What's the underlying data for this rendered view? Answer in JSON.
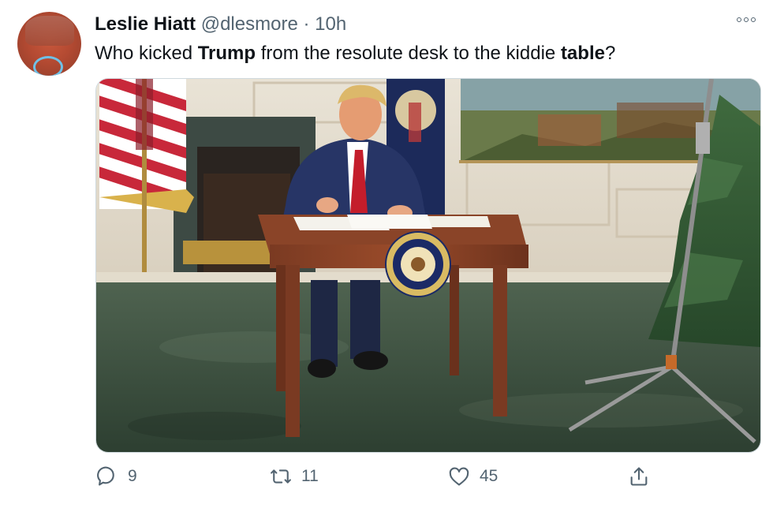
{
  "tweet": {
    "author_name": "Leslie Hiatt",
    "handle": "@dlesmore",
    "separator": "·",
    "time": "10h",
    "text_parts": [
      "Who kicked ",
      "Trump",
      " from the resolute desk to the kiddie ",
      "table",
      "?"
    ],
    "media_seal_text": "SEAL OF THE PRESIDENT OF THE UNITED STATES"
  },
  "actions": {
    "reply_count": "9",
    "retweet_count": "11",
    "like_count": "45"
  },
  "icons": [
    "more-icon",
    "reply-icon",
    "retweet-icon",
    "like-icon",
    "share-icon"
  ],
  "colors": {
    "text": "#0f1419",
    "secondary": "#536471",
    "border": "#cfd9de"
  }
}
